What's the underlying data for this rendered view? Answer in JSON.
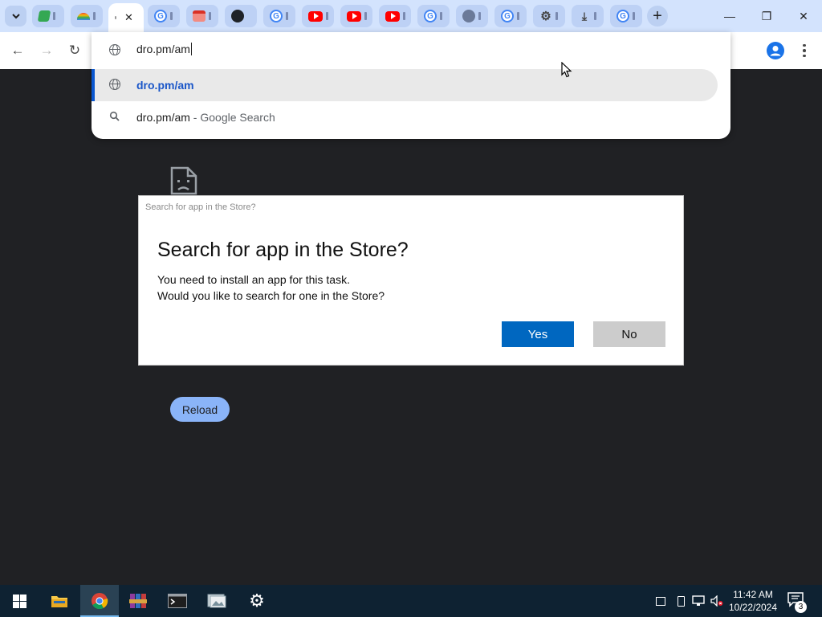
{
  "browser": {
    "tabs": [
      {
        "icon": "app-icon"
      },
      {
        "icon": "rainbow-icon"
      },
      {
        "icon": "globe-icon",
        "active": true,
        "close_label": "✕"
      },
      {
        "icon": "google-icon"
      },
      {
        "icon": "calendar-icon"
      },
      {
        "icon": "github-icon"
      },
      {
        "icon": "google-icon"
      },
      {
        "icon": "youtube-icon"
      },
      {
        "icon": "youtube-icon"
      },
      {
        "icon": "youtube-icon"
      },
      {
        "icon": "google-icon"
      },
      {
        "icon": "github-icon"
      },
      {
        "icon": "google-icon"
      },
      {
        "icon": "settings-icon"
      },
      {
        "icon": "download-icon"
      },
      {
        "icon": "google-icon"
      }
    ],
    "new_tab_label": "+",
    "window_controls": {
      "minimize": "—",
      "restore": "❐",
      "close": "✕"
    },
    "nav": {
      "back": "←",
      "forward": "→",
      "reload": "↻"
    }
  },
  "omnibox": {
    "value": "dro.pm/am",
    "suggestions": [
      {
        "text": "dro.pm/am",
        "description": "",
        "icon": "globe-icon",
        "selected": true
      },
      {
        "text": "dro.pm/am",
        "description": " - Google Search",
        "icon": "search-icon",
        "selected": false
      }
    ]
  },
  "error_page": {
    "reload_label": "Reload"
  },
  "dialog": {
    "caption": "Search for app in the Store?",
    "title": "Search for app in the Store?",
    "message_line1": "You need to install an app for this task.",
    "message_line2": "Would you like to search for one in the Store?",
    "yes_label": "Yes",
    "no_label": "No"
  },
  "taskbar": {
    "apps": [
      "start-icon",
      "file-explorer-icon",
      "chrome-icon",
      "winrar-icon",
      "terminal-icon",
      "photos-icon",
      "settings-icon"
    ],
    "time": "11:42 AM",
    "date": "10/22/2024",
    "notification_count": "3"
  },
  "colors": {
    "accent": "#0067c0",
    "page_bg": "#202124",
    "tabstrip_bg": "#d3e3fd",
    "reload_bg": "#8ab4f8"
  }
}
